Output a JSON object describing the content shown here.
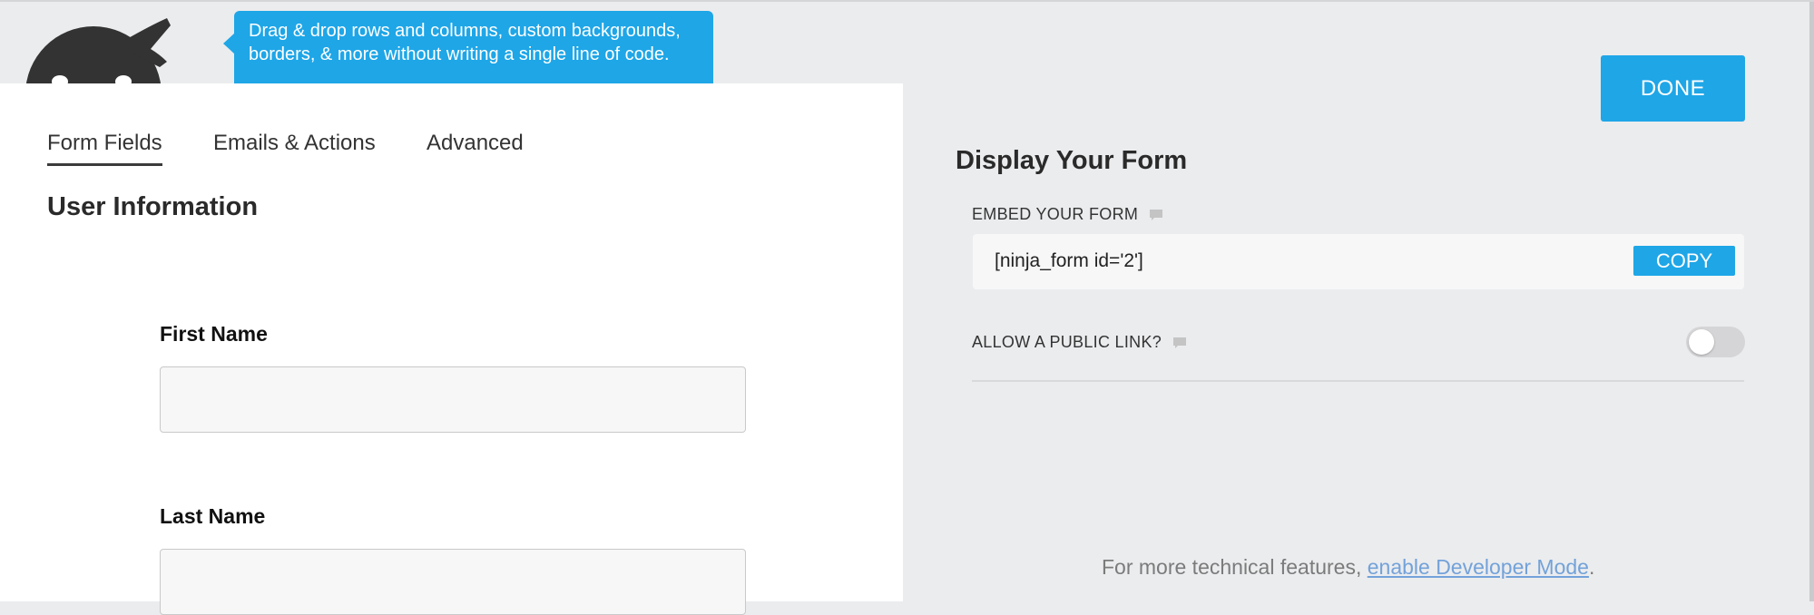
{
  "tooltip": {
    "text": "Drag & drop rows and columns, custom backgrounds, borders, & more without writing a single line of code."
  },
  "tabs": [
    {
      "label": "Form Fields",
      "active": true
    },
    {
      "label": "Emails & Actions",
      "active": false
    },
    {
      "label": "Advanced",
      "active": false
    }
  ],
  "form": {
    "section_title": "User Information",
    "fields": [
      {
        "label": "First Name",
        "value": ""
      },
      {
        "label": "Last Name",
        "value": ""
      }
    ]
  },
  "display": {
    "done_label": "DONE",
    "title": "Display Your Form",
    "embed_label": "EMBED YOUR FORM",
    "embed_code": "[ninja_form id='2']",
    "copy_label": "COPY",
    "public_link_label": "ALLOW A PUBLIC LINK?",
    "public_link_enabled": false,
    "footer_prefix": "For more technical features, ",
    "footer_link": "enable Developer Mode",
    "footer_suffix": "."
  },
  "colors": {
    "accent": "#1ea6e7",
    "background": "#ebecee",
    "panel": "#ffffff",
    "link": "#73a2d9",
    "logo": "#333333"
  },
  "icons": {
    "logo": "ninja-mascot-icon",
    "help": "comment-icon"
  }
}
